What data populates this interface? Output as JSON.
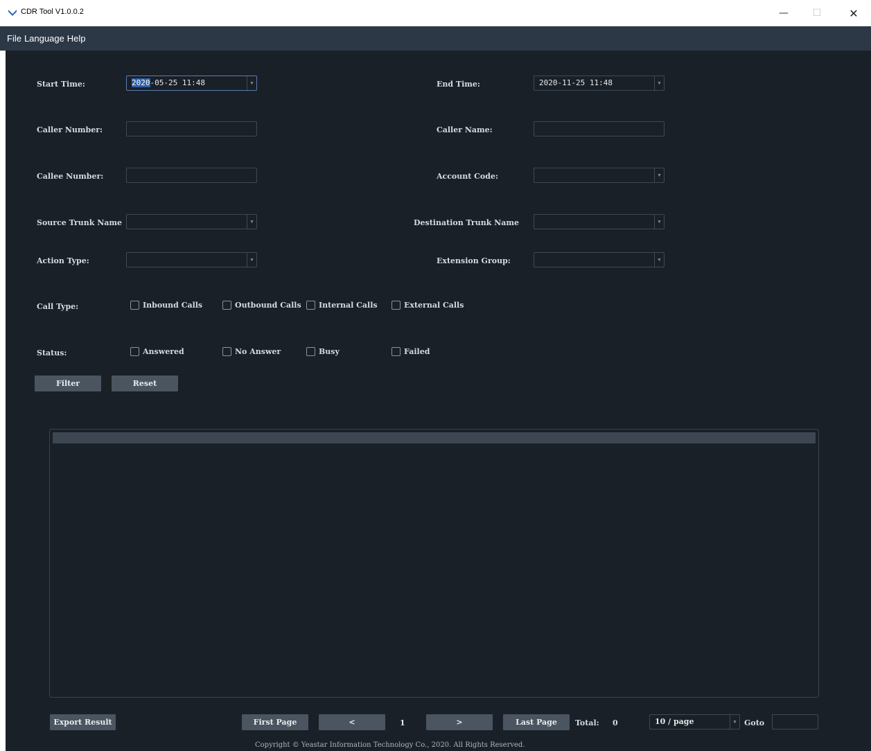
{
  "window": {
    "title": "CDR Tool V1.0.0.2",
    "minimize_glyph": "—",
    "maximize_glyph": "☐",
    "close_glyph": "✕"
  },
  "menu": [
    "File",
    "Language",
    "Help"
  ],
  "filters": {
    "start_time_label": "Start Time:",
    "start_time_highlight": "2020",
    "start_time_rest": "-05-25 11:48",
    "end_time_label": "End Time:",
    "end_time_value": "2020-11-25 11:48",
    "caller_number_label": "Caller Number:",
    "caller_number_value": "",
    "caller_name_label": "Caller Name:",
    "caller_name_value": "",
    "callee_number_label": "Callee Number:",
    "callee_number_value": "",
    "account_code_label": "Account Code:",
    "account_code_value": "",
    "source_trunk_label": "Source Trunk Name",
    "source_trunk_value": "",
    "destination_trunk_label": "Destination Trunk Name",
    "destination_trunk_value": "",
    "action_type_label": "Action Type:",
    "action_type_value": "",
    "extension_group_label": "Extension Group:",
    "extension_group_value": "",
    "call_type_label": "Call Type:",
    "call_types": [
      "Inbound Calls",
      "Outbound Calls",
      "Internal Calls",
      "External Calls"
    ],
    "status_label": "Status:",
    "statuses": [
      "Answered",
      "No Answer",
      "Busy",
      "Failed"
    ],
    "filter_button": "Filter",
    "reset_button": "Reset"
  },
  "pagination": {
    "export_button": "Export Result",
    "first_page": "First Page",
    "prev": "<",
    "current_page": "1",
    "next": ">",
    "last_page": "Last Page",
    "total_label": "Total:",
    "total_value": "0",
    "page_size": "10 / page",
    "goto_label": "Goto",
    "goto_value": ""
  },
  "footer": "Copyright © Yeastar Information Technology Co., 2020. All Rights Reserved.",
  "colors": {
    "background": "#1a2027",
    "menubar": "#2c3846",
    "button": "#4a5561"
  }
}
